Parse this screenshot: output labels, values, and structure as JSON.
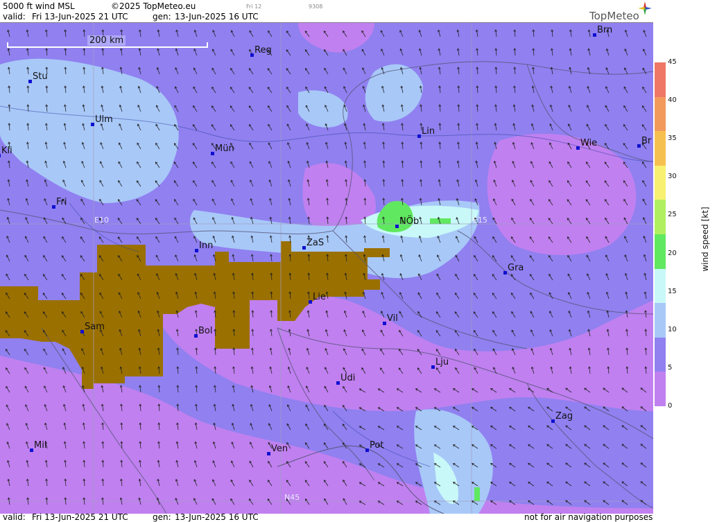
{
  "header": {
    "title": "5000 ft wind MSL",
    "copyright": "©2025 TopMeteo.eu",
    "small_day": "Fri 12",
    "small_code": "9308",
    "valid_label": "valid:",
    "valid_value": "Fri  13-Jun-2025  21 UTC",
    "gen_label": "gen:",
    "gen_value": "13-Jun-2025 16 UTC",
    "logo": "TopMeteo"
  },
  "footer": {
    "valid_label": "valid:",
    "valid_value": "Fri  13-Jun-2025  21 UTC",
    "gen_label": "gen:",
    "gen_value": "13-Jun-2025 16 UTC",
    "disclaimer": "not for air navigation purposes"
  },
  "map": {
    "scale_label": "200 km",
    "grid_labels": {
      "e10": "E10",
      "e15": "E15",
      "n45": "N45"
    },
    "cities": [
      {
        "name": "Brn"
      },
      {
        "name": "Reg"
      },
      {
        "name": "Stu"
      },
      {
        "name": "Ulm"
      },
      {
        "name": "Lin"
      },
      {
        "name": "Kli"
      },
      {
        "name": "Mün"
      },
      {
        "name": "Wie"
      },
      {
        "name": "Br"
      },
      {
        "name": "Fri"
      },
      {
        "name": "NÖb"
      },
      {
        "name": "Inn"
      },
      {
        "name": "ZaS"
      },
      {
        "name": "Gra"
      },
      {
        "name": "Lie"
      },
      {
        "name": "Sam"
      },
      {
        "name": "Vil"
      },
      {
        "name": "Bol"
      },
      {
        "name": "Lju"
      },
      {
        "name": "Udi"
      },
      {
        "name": "Zag"
      },
      {
        "name": "Mil"
      },
      {
        "name": "Ven"
      },
      {
        "name": "Pot"
      }
    ],
    "colors": {
      "terrain": "#9a7000",
      "wind_0_5": "#c080f0",
      "wind_5_10": "#9080f0",
      "wind_10_15": "#a8c8f8",
      "wind_15_20": "#c8f8f8",
      "wind_20_25": "#60e860"
    }
  },
  "legend": {
    "label": "wind speed [kt]",
    "ticks": [
      "45",
      "40",
      "35",
      "30",
      "25",
      "20",
      "15",
      "10",
      "5",
      "0"
    ],
    "colors": [
      "#ee7766",
      "#f29a5c",
      "#f6c050",
      "#f8f070",
      "#b0f060",
      "#60e860",
      "#c8f8f8",
      "#a8c8f8",
      "#9080f0",
      "#c080f0"
    ]
  }
}
